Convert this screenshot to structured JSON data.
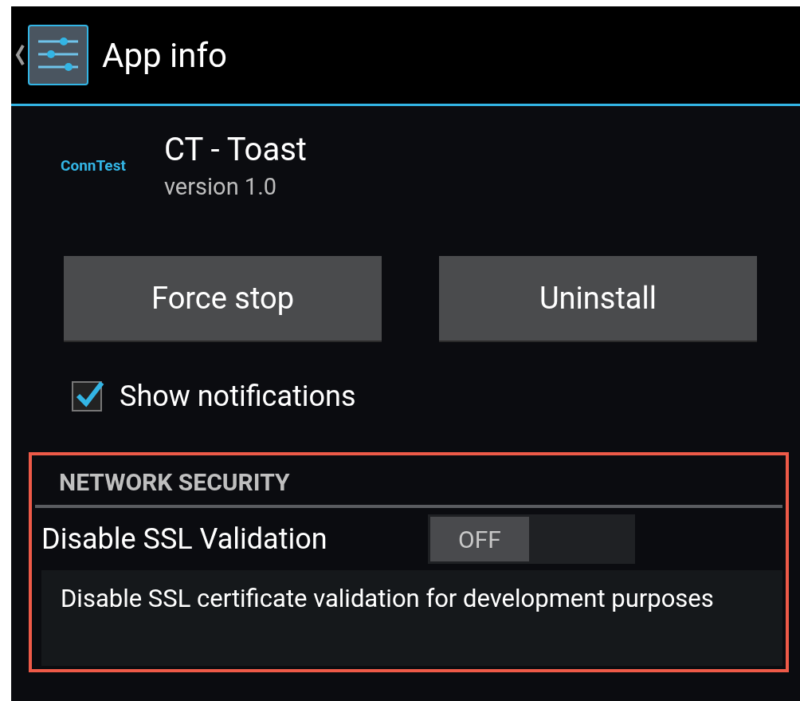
{
  "action_bar": {
    "title": "App info"
  },
  "app": {
    "icon_text": "ConnTest",
    "name": "CT - Toast",
    "version": "version 1.0"
  },
  "buttons": [
    {
      "label": "Force stop"
    },
    {
      "label": "Uninstall"
    }
  ],
  "notifications": {
    "label": "Show notifications",
    "checked": true
  },
  "section": {
    "title": "NETWORK SECURITY",
    "highlighted": true,
    "setting": {
      "label": "Disable SSL Validation",
      "on": false,
      "toggle_text": "OFF",
      "summary": "Disable SSL certificate validation for development purposes"
    }
  }
}
